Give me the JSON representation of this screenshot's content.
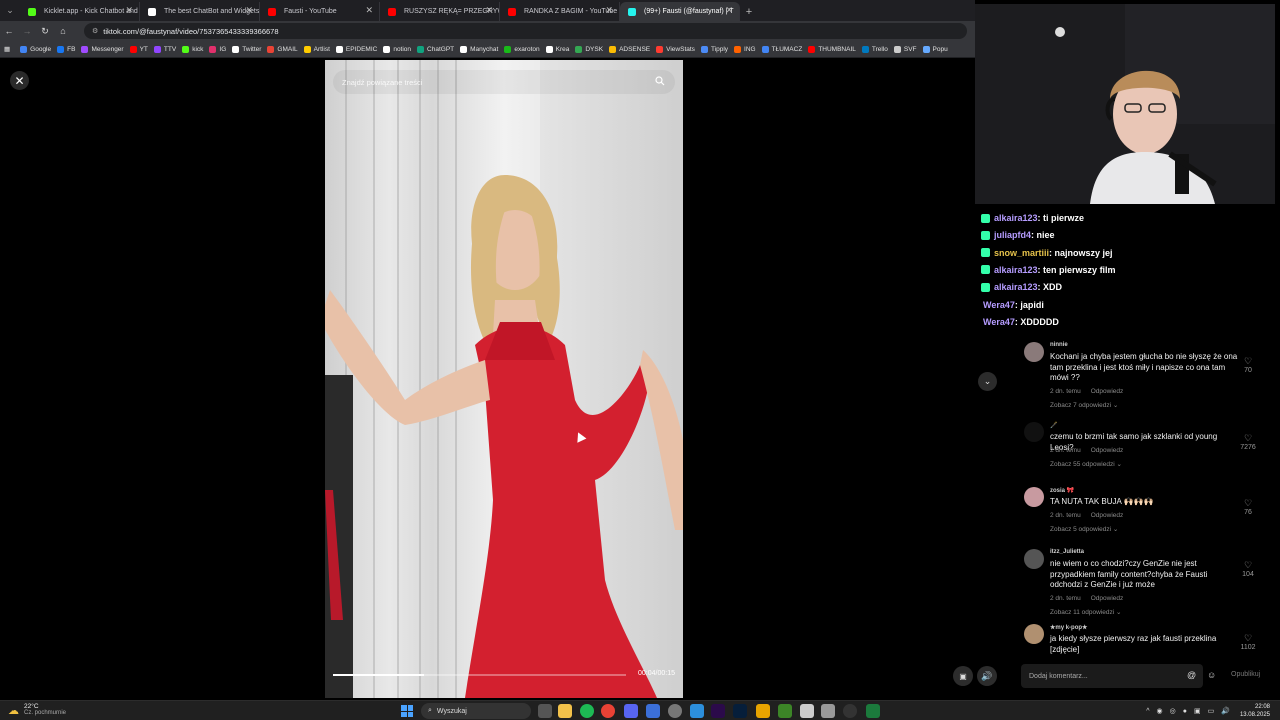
{
  "browser": {
    "tabs": [
      {
        "label": "Kicklet.app - Kick Chatbot and",
        "color": "#53fc18"
      },
      {
        "label": "The best ChatBot and Widgets",
        "color": "#ffffff"
      },
      {
        "label": "Fausti - YouTube",
        "color": "#ff0000"
      },
      {
        "label": "RUSZYSZ RĘKĄ= PRZEGRYWASZ",
        "color": "#ff0000"
      },
      {
        "label": "RANDKA Z BAGIM - YouTube",
        "color": "#ff0000"
      },
      {
        "label": "(99+) Fausti (@faustynaf) | T",
        "color": "#25f4ee"
      }
    ],
    "url": "tiktok.com/@faustynaf/video/7537365433339366678",
    "bookmarks": [
      {
        "label": "Google",
        "color": "#4285f4"
      },
      {
        "label": "FB",
        "color": "#1877f2"
      },
      {
        "label": "Messenger",
        "color": "#a04bff"
      },
      {
        "label": "YT",
        "color": "#ff0000"
      },
      {
        "label": "TTV",
        "color": "#9146ff"
      },
      {
        "label": "kick",
        "color": "#53fc18"
      },
      {
        "label": "IG",
        "color": "#e1306c"
      },
      {
        "label": "Twitter",
        "color": "#ffffff"
      },
      {
        "label": "GMAIL",
        "color": "#ea4335"
      },
      {
        "label": "Artlist",
        "color": "#ffcc00"
      },
      {
        "label": "EPIDEMIC",
        "color": "#ffffff"
      },
      {
        "label": "notion",
        "color": "#ffffff"
      },
      {
        "label": "ChatGPT",
        "color": "#10a37f"
      },
      {
        "label": "Manychat",
        "color": "#ffffff"
      },
      {
        "label": "exaroton",
        "color": "#19ba19"
      },
      {
        "label": "Krea",
        "color": "#ffffff"
      },
      {
        "label": "DYSK",
        "color": "#34a853"
      },
      {
        "label": "ADSENSE",
        "color": "#fbbc04"
      },
      {
        "label": "ViewStats",
        "color": "#ff3b30"
      },
      {
        "label": "Tipply",
        "color": "#4c8bf5"
      },
      {
        "label": "ING",
        "color": "#ff6200"
      },
      {
        "label": "TŁUMACZ",
        "color": "#4285f4"
      },
      {
        "label": "THUMBNAIL",
        "color": "#ff0000"
      },
      {
        "label": "Trello",
        "color": "#0079bf"
      },
      {
        "label": "SVF",
        "color": "#cccccc"
      },
      {
        "label": "Popu",
        "color": "#66aaff"
      }
    ]
  },
  "video": {
    "search_placeholder": "Znajdź powiązane treści",
    "time": "00:04/00:15",
    "progress": 0.31
  },
  "chat": [
    {
      "user": "alkaira123",
      "msg": ": ti pierwze",
      "color": "#b59cff"
    },
    {
      "user": "juliapfd4",
      "msg": ": niee",
      "color": "#b59cff"
    },
    {
      "user": "snow_martiii",
      "msg": ": najnowszy jej",
      "color": "#e6c24a"
    },
    {
      "user": "alkaira123",
      "msg": ": ten pierwszy film",
      "color": "#b59cff"
    },
    {
      "user": "alkaira123",
      "msg": ": XDD",
      "color": "#b59cff"
    },
    {
      "user": "Wera47",
      "msg": ": japidi",
      "color": "#b59cff"
    },
    {
      "user": "Wera47",
      "msg": ": XDDDDD",
      "color": "#b59cff"
    }
  ],
  "comments": [
    {
      "user": "ninnie",
      "text": "Kochani ja chyba jestem głucha bo nie słyszę że ona tam przeklina i jest ktoś miły i napisze co ona tam mówi ??",
      "age": "2 dn. temu",
      "reply": "Odpowiedz",
      "more": "Zobacz 7 odpowiedzi",
      "likes": "70"
    },
    {
      "user": "🖋️",
      "text": "czemu to brzmi tak samo jak szklanki od young Leosi?",
      "age": "2 dn. temu",
      "reply": "Odpowiedz",
      "more": "Zobacz 55 odpowiedzi",
      "likes": "7276"
    },
    {
      "user": "zosia 🎀",
      "text": "TA NUTA TAK BUJA 🙌🏻🙌🏻🙌🏻",
      "age": "2 dn. temu",
      "reply": "Odpowiedz",
      "more": "Zobacz 5 odpowiedzi",
      "likes": "76"
    },
    {
      "user": "itzz_Julietta",
      "text": "nie wiem o co chodzi?czy GenZie nie jest przypadkiem family content?chyba że Fausti odchodzi z GenZie i już może",
      "age": "2 dn. temu",
      "reply": "Odpowiedz",
      "more": "Zobacz 11 odpowiedzi",
      "likes": "104"
    },
    {
      "user": "★my k-pop★",
      "text": "ja kiedy słysze pierwszy raz jak fausti przeklina [zdjęcie]",
      "age": "",
      "reply": "",
      "more": "",
      "likes": "1102"
    }
  ],
  "comment_box": {
    "placeholder": "Dodaj komentarz...",
    "post": "Opublikuj"
  },
  "taskbar": {
    "temp": "22°C",
    "weather": "Cz. pochmurnie",
    "search": "Wyszukaj",
    "time": "22:08",
    "date": "13.08.2025"
  }
}
